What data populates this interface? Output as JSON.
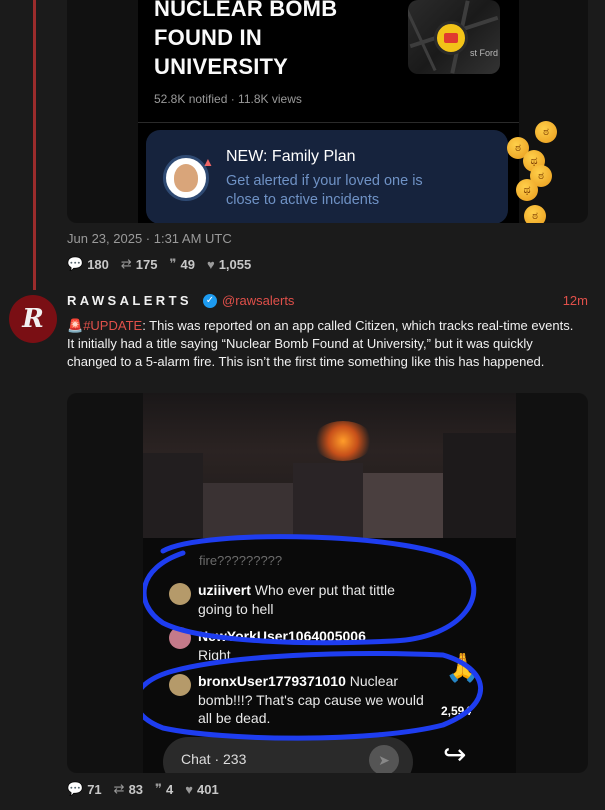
{
  "first_post": {
    "embed": {
      "headline": "NUCLEAR BOMB FOUND IN UNIVERSITY",
      "stats": "52.8K notified · 11.8K views",
      "map_label": "st Ford",
      "promo_title": "NEW: Family Plan",
      "promo_subtitle": "Get alerted if your loved one is close to active incidents"
    },
    "date": "Jun 23, 2025 · 1:31 AM UTC",
    "replies": "180",
    "reposts": "175",
    "quotes": "49",
    "likes": "1,055"
  },
  "second_post": {
    "author": "RAWSALERTS",
    "handle": "@rawsalerts",
    "time": "12m",
    "tag": "#UPDATE",
    "text": ": This was reported on an app called Citizen, which tracks real-time events. It initially had a title saying “Nuclear Bomb Found at University,” but it was quickly changed to a 5-alarm fire. This isn’t the first time something like this has happened.",
    "video": {
      "ghost_text": "fire?????????",
      "comments": [
        {
          "user": "uziiivert",
          "text": "Who ever put that tittle going to hell"
        },
        {
          "user": "NewYorkUser1064005006",
          "text": "Right"
        },
        {
          "user": "bronxUser1779371010",
          "text": "Nuclear bomb!!!? That's cap cause we would all be dead."
        }
      ],
      "reaction_count": "2,594",
      "chat_label": "Chat · 233"
    },
    "replies": "71",
    "reposts": "83",
    "quotes": "4",
    "likes": "401"
  },
  "colors": {
    "accent_red": "#e0504a",
    "thread_line": "#9b2c2c",
    "promo_bg": "#16233d",
    "circle_blue": "#1e3df0"
  },
  "icons": [
    "reply-icon",
    "repost-icon",
    "quote-icon",
    "heart-icon",
    "verified-icon",
    "siren-icon",
    "pray-icon",
    "share-icon",
    "send-icon"
  ]
}
